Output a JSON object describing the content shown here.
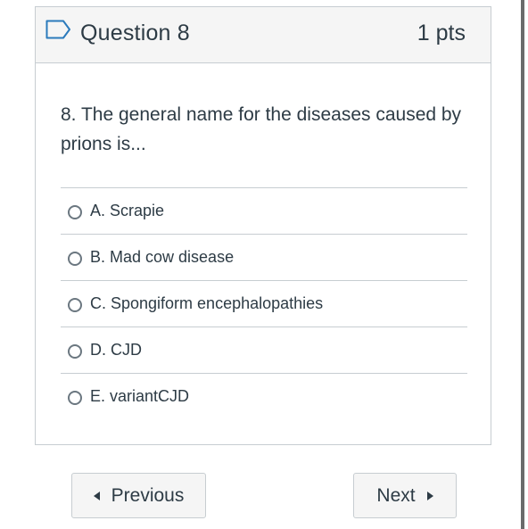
{
  "question": {
    "title": "Question 8",
    "points": "1 pts",
    "flag_icon": "flag-outline-icon",
    "text": "8. The general name for the diseases caused by prions is...",
    "answers": [
      {
        "label": "A. Scrapie"
      },
      {
        "label": "B. Mad cow disease"
      },
      {
        "label": "C. Spongiform encephalopathies"
      },
      {
        "label": "D. CJD"
      },
      {
        "label": "E. variantCJD"
      }
    ]
  },
  "navigation": {
    "previous_label": "Previous",
    "next_label": "Next",
    "previous_icon": "triangle-left-icon",
    "next_icon": "triangle-right-icon"
  },
  "colors": {
    "header_bg": "#f5f5f5",
    "border": "#c7cdd1",
    "text": "#2d3b45",
    "flag": "#2b7abc"
  }
}
